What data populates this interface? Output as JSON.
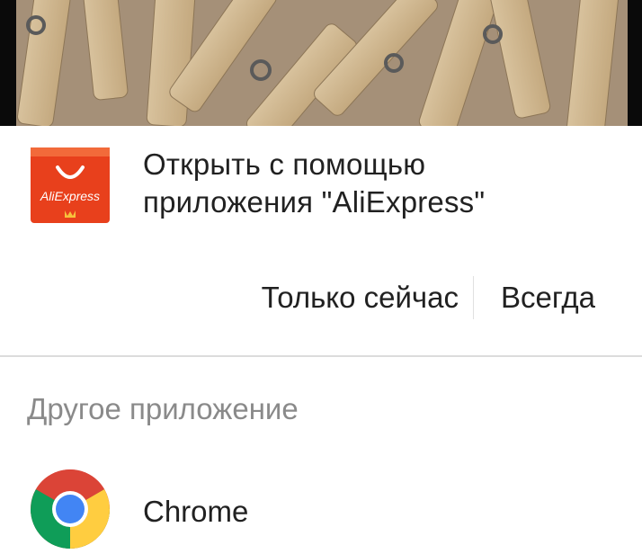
{
  "dialog": {
    "open_with_line1": "Открыть с помощью",
    "open_with_line2": "приложения \"AliExpress\"",
    "suggested_app": {
      "name": "AliExpress",
      "icon_text": "AliExpress",
      "icon": "aliexpress-icon",
      "color": "#e8401c"
    },
    "just_once_label": "Только сейчас",
    "always_label": "Всегда",
    "other_apps_header": "Другое приложение",
    "other_apps": [
      {
        "name": "Chrome",
        "icon": "chrome-icon"
      }
    ]
  },
  "colors": {
    "sheet_bg": "#ffffff",
    "text_primary": "#212121",
    "text_secondary": "#8a8a8a",
    "divider": "#dcdcdc"
  }
}
